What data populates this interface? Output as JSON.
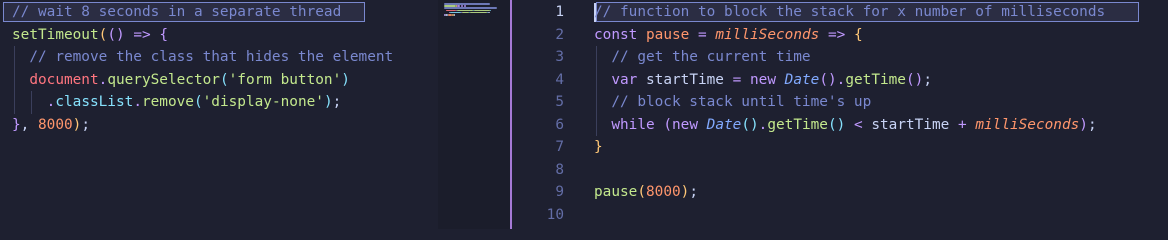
{
  "colors": {
    "background": "#1e2030",
    "minimap": "#1b1d2b",
    "splitter": "#a67ad6",
    "comment": "#7a88cf",
    "keyword": "#c099ff",
    "function": "#c3e88d",
    "parameter": "#ff966c",
    "class": "#82aaff",
    "line_number": "#636da6"
  },
  "left_editor": {
    "lines": [
      [
        {
          "t": "// wait 8 seconds in a separate thread",
          "c": "comment"
        }
      ],
      [
        {
          "t": "setTimeout",
          "c": "func"
        },
        {
          "t": "(",
          "c": "paren1"
        },
        {
          "t": "()",
          "c": "paren2"
        },
        {
          "t": " ",
          "c": "punc"
        },
        {
          "t": "=>",
          "c": "op"
        },
        {
          "t": " ",
          "c": "punc"
        },
        {
          "t": "{",
          "c": "paren2"
        }
      ],
      [
        {
          "t": "  // remove the class that hides the element",
          "c": "comment"
        }
      ],
      [
        {
          "t": "  ",
          "c": "punc"
        },
        {
          "t": "document",
          "c": "obj"
        },
        {
          "t": ".",
          "c": "op"
        },
        {
          "t": "querySelector",
          "c": "method"
        },
        {
          "t": "(",
          "c": "paren3"
        },
        {
          "t": "'form button'",
          "c": "string"
        },
        {
          "t": ")",
          "c": "paren3"
        }
      ],
      [
        {
          "t": "    ",
          "c": "punc"
        },
        {
          "t": ".",
          "c": "op"
        },
        {
          "t": "classList",
          "c": "prop"
        },
        {
          "t": ".",
          "c": "op"
        },
        {
          "t": "remove",
          "c": "method"
        },
        {
          "t": "(",
          "c": "paren3"
        },
        {
          "t": "'display-none'",
          "c": "string"
        },
        {
          "t": ")",
          "c": "paren3"
        },
        {
          "t": ";",
          "c": "punc"
        }
      ],
      [
        {
          "t": "}",
          "c": "paren2"
        },
        {
          "t": ", ",
          "c": "punc"
        },
        {
          "t": "8000",
          "c": "number"
        },
        {
          "t": ")",
          "c": "paren1"
        },
        {
          "t": ";",
          "c": "punc"
        }
      ]
    ]
  },
  "right_editor": {
    "line_numbers": [
      "1",
      "2",
      "3",
      "4",
      "5",
      "6",
      "7",
      "8",
      "9",
      "10"
    ],
    "lines": [
      [
        {
          "t": "// function to block the stack for x number of milliseconds",
          "c": "comment"
        }
      ],
      [
        {
          "t": "const",
          "c": "keyword"
        },
        {
          "t": " ",
          "c": "punc"
        },
        {
          "t": "pause",
          "c": "var"
        },
        {
          "t": " ",
          "c": "punc"
        },
        {
          "t": "=",
          "c": "op"
        },
        {
          "t": " ",
          "c": "punc"
        },
        {
          "t": "milliSeconds",
          "c": "param"
        },
        {
          "t": " ",
          "c": "punc"
        },
        {
          "t": "=>",
          "c": "op"
        },
        {
          "t": " ",
          "c": "punc"
        },
        {
          "t": "{",
          "c": "paren1"
        }
      ],
      [
        {
          "t": "  // get the current time",
          "c": "comment"
        }
      ],
      [
        {
          "t": "  ",
          "c": "punc"
        },
        {
          "t": "var",
          "c": "keyword"
        },
        {
          "t": " ",
          "c": "punc"
        },
        {
          "t": "startTime",
          "c": "ident"
        },
        {
          "t": " ",
          "c": "punc"
        },
        {
          "t": "=",
          "c": "op"
        },
        {
          "t": " ",
          "c": "punc"
        },
        {
          "t": "new",
          "c": "keyword"
        },
        {
          "t": " ",
          "c": "punc"
        },
        {
          "t": "Date",
          "c": "class"
        },
        {
          "t": "()",
          "c": "paren2"
        },
        {
          "t": ".",
          "c": "op"
        },
        {
          "t": "getTime",
          "c": "method"
        },
        {
          "t": "()",
          "c": "paren2"
        },
        {
          "t": ";",
          "c": "punc"
        }
      ],
      [
        {
          "t": "  // block stack until time's up",
          "c": "comment"
        }
      ],
      [
        {
          "t": "  ",
          "c": "punc"
        },
        {
          "t": "while",
          "c": "keyword"
        },
        {
          "t": " ",
          "c": "punc"
        },
        {
          "t": "(",
          "c": "paren2"
        },
        {
          "t": "new",
          "c": "keyword"
        },
        {
          "t": " ",
          "c": "punc"
        },
        {
          "t": "Date",
          "c": "class"
        },
        {
          "t": "()",
          "c": "paren3"
        },
        {
          "t": ".",
          "c": "op"
        },
        {
          "t": "getTime",
          "c": "method"
        },
        {
          "t": "()",
          "c": "paren3"
        },
        {
          "t": " ",
          "c": "punc"
        },
        {
          "t": "<",
          "c": "op"
        },
        {
          "t": " ",
          "c": "punc"
        },
        {
          "t": "startTime",
          "c": "ident"
        },
        {
          "t": " ",
          "c": "punc"
        },
        {
          "t": "+",
          "c": "op"
        },
        {
          "t": " ",
          "c": "punc"
        },
        {
          "t": "milliSeconds",
          "c": "param"
        },
        {
          "t": ")",
          "c": "paren2"
        },
        {
          "t": ";",
          "c": "punc"
        }
      ],
      [
        {
          "t": "}",
          "c": "paren1"
        }
      ],
      [],
      [
        {
          "t": "pause",
          "c": "func"
        },
        {
          "t": "(",
          "c": "paren1"
        },
        {
          "t": "8000",
          "c": "number"
        },
        {
          "t": ")",
          "c": "paren1"
        },
        {
          "t": ";",
          "c": "punc"
        }
      ],
      []
    ]
  }
}
